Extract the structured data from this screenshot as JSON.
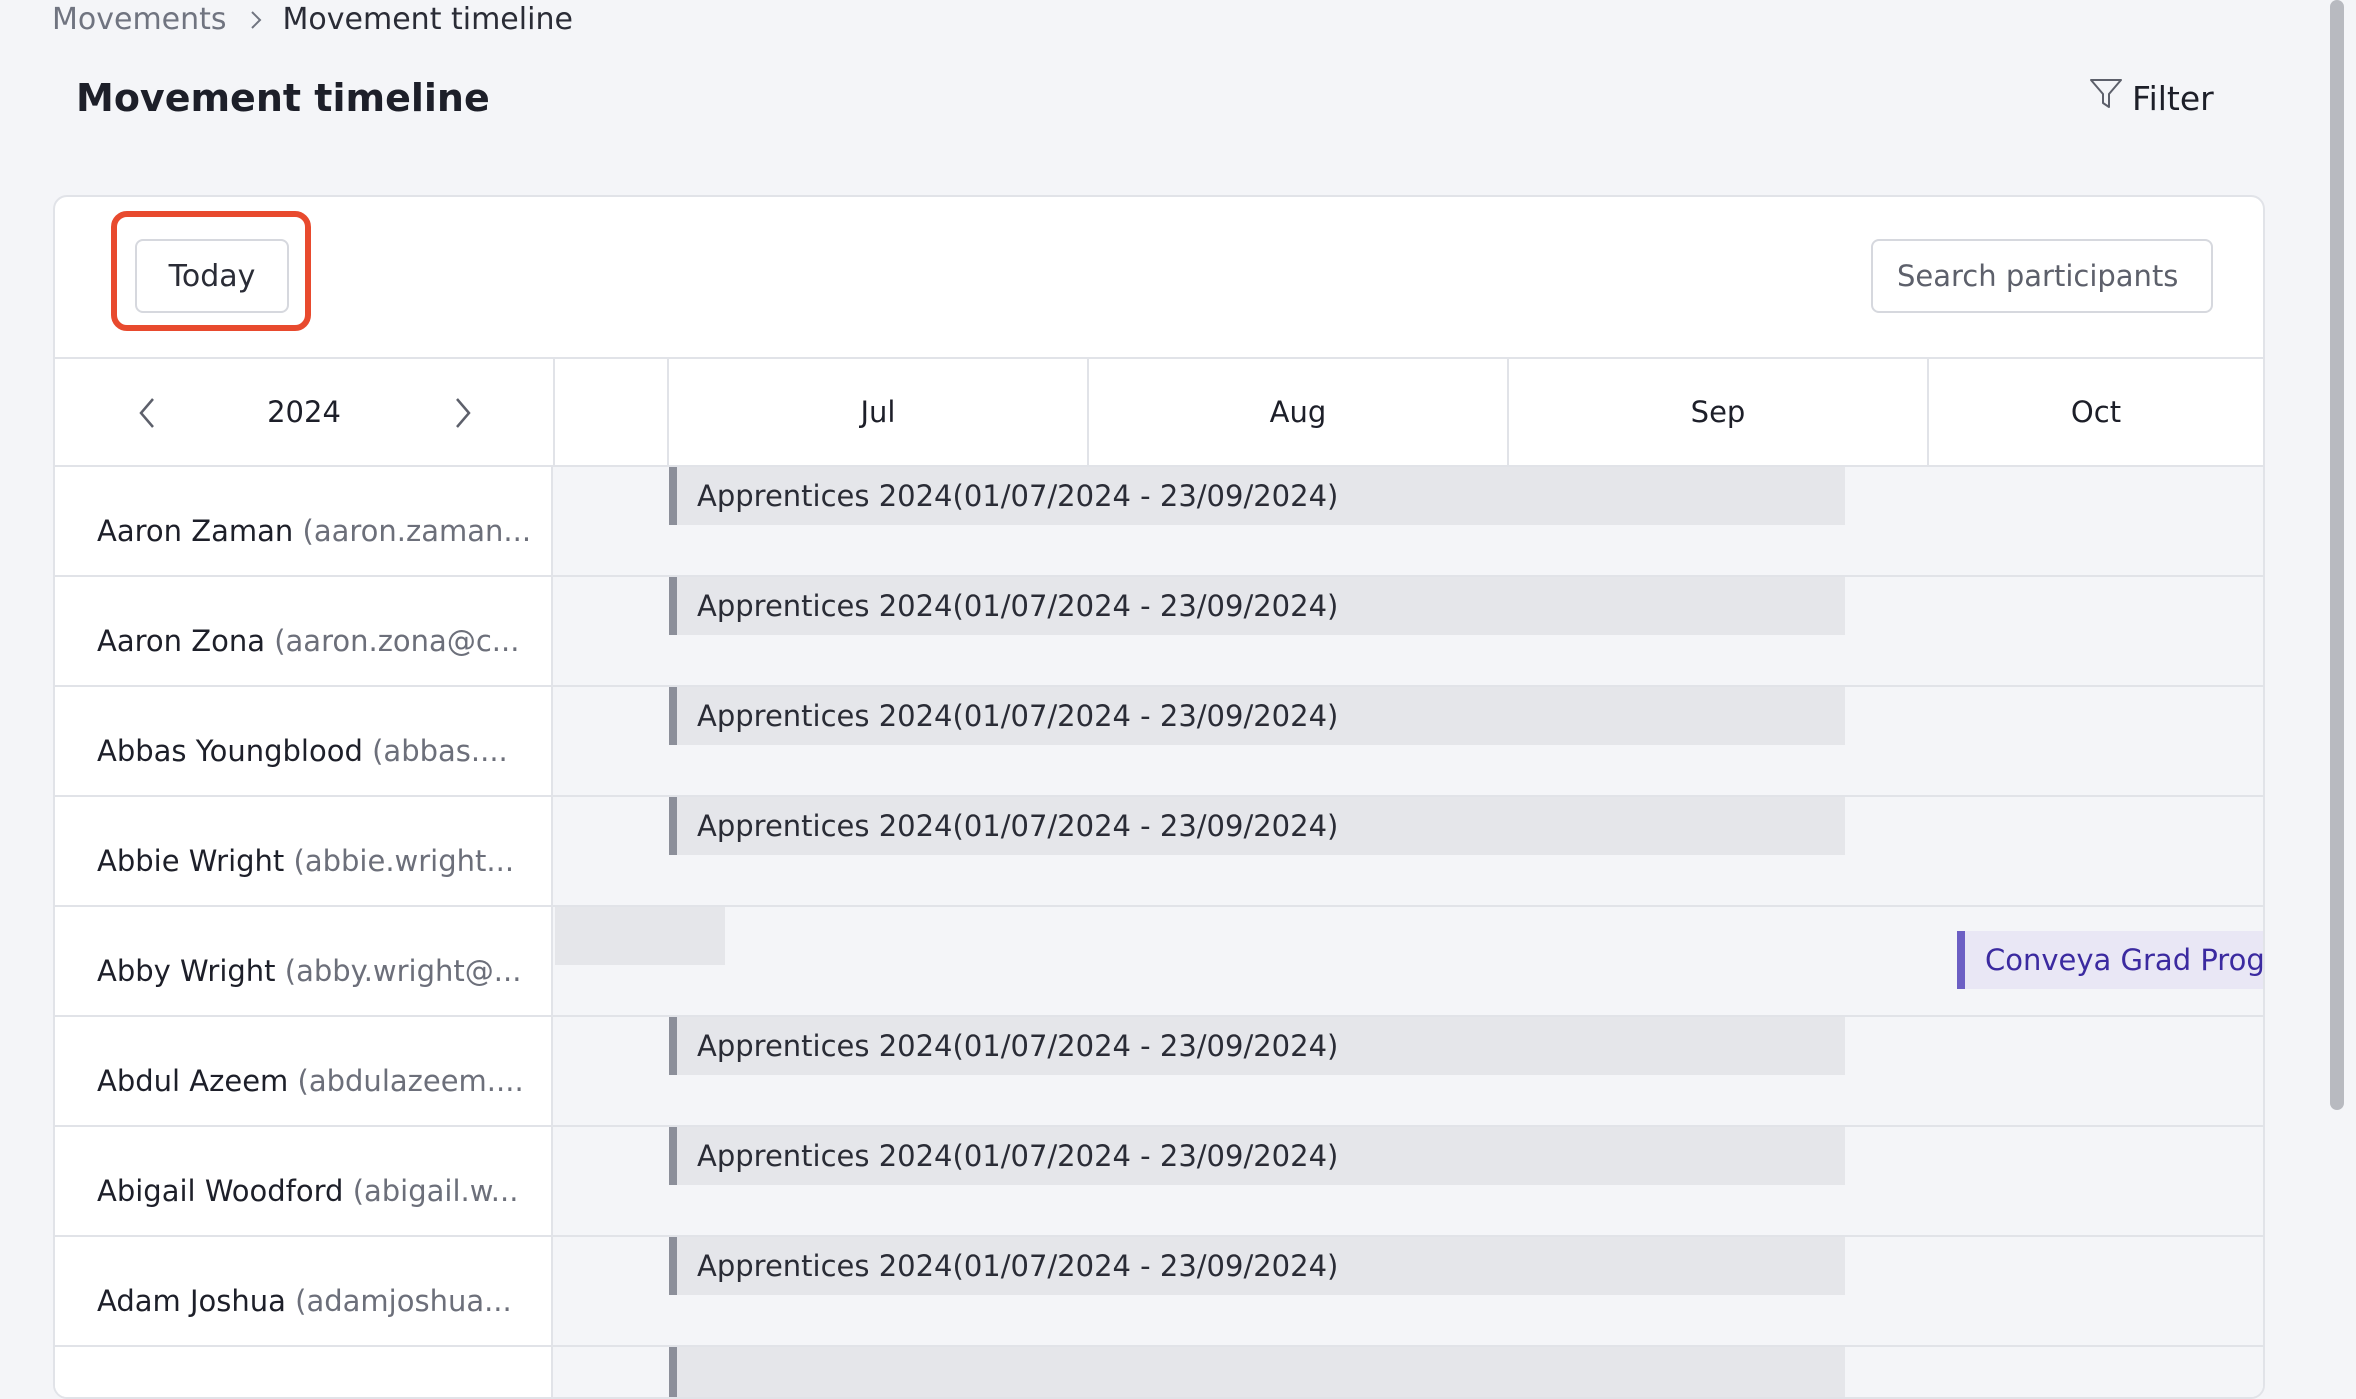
{
  "breadcrumb": {
    "parent": "Movements",
    "current": "Movement timeline"
  },
  "header": {
    "title": "Movement timeline",
    "filter_label": "Filter"
  },
  "toolbar": {
    "today_label": "Today",
    "search_placeholder": "Search participants"
  },
  "timeline": {
    "year": "2024",
    "months": [
      "Jul",
      "Aug",
      "Sep",
      "Oct"
    ]
  },
  "rows": [
    {
      "name": "Aaron Zaman",
      "email": "(aaron.zaman...",
      "bar_label": "Apprentices 2024(01/07/2024 - 23/09/2024)"
    },
    {
      "name": "Aaron Zona",
      "email": "(aaron.zona@c...",
      "bar_label": "Apprentices 2024(01/07/2024 - 23/09/2024)"
    },
    {
      "name": "Abbas Youngblood",
      "email": "(abbas....",
      "bar_label": "Apprentices 2024(01/07/2024 - 23/09/2024)"
    },
    {
      "name": "Abbie Wright",
      "email": "(abbie.wright...",
      "bar_label": "Apprentices 2024(01/07/2024 - 23/09/2024)"
    },
    {
      "name": "Abby Wright",
      "email": "(abby.wright@...",
      "bar_label": "Conveya Grad Progr"
    },
    {
      "name": "Abdul Azeem",
      "email": "(abdulazeem....",
      "bar_label": "Apprentices 2024(01/07/2024 - 23/09/2024)"
    },
    {
      "name": "Abigail Woodford",
      "email": "(abigail.w...",
      "bar_label": "Apprentices 2024(01/07/2024 - 23/09/2024)"
    },
    {
      "name": "Adam Joshua",
      "email": "(adamjoshua...",
      "bar_label": "Apprentices 2024(01/07/2024 - 23/09/2024)"
    }
  ],
  "colors": {
    "highlight": "#e84a2e",
    "bar_grey": "#e5e6ea",
    "bar_purple_accent": "#6c5fc4"
  }
}
